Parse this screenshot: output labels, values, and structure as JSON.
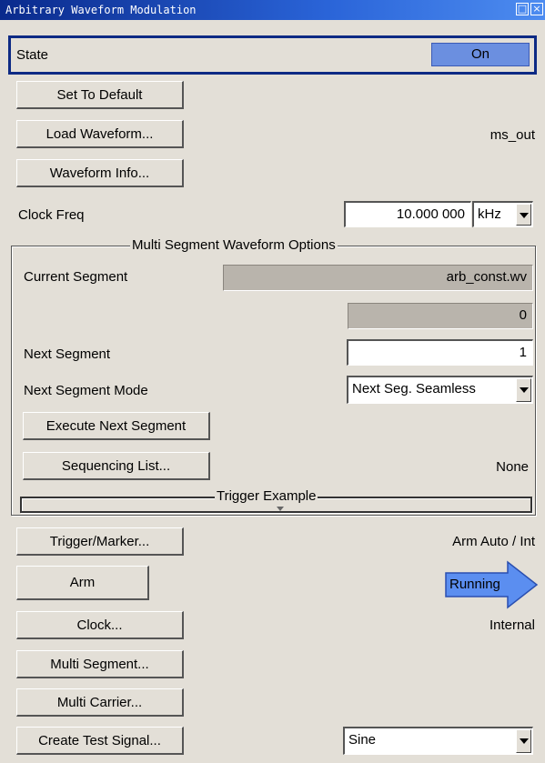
{
  "window": {
    "title": "Arbitrary Waveform Modulation"
  },
  "state": {
    "label": "State",
    "value": "On"
  },
  "buttons": {
    "set_default": "Set To Default",
    "load_waveform": "Load Waveform...",
    "waveform_info": "Waveform Info...",
    "execute_next": "Execute Next Segment",
    "sequencing_list": "Sequencing List...",
    "trigger_marker": "Trigger/Marker...",
    "arm": "Arm",
    "clock": "Clock...",
    "multi_segment": "Multi Segment...",
    "multi_carrier": "Multi Carrier...",
    "create_test_signal": "Create Test Signal..."
  },
  "waveform_file": "ms_out",
  "clock_freq": {
    "label": "Clock Freq",
    "value": "10.000 000",
    "unit": "kHz"
  },
  "multi_segment": {
    "title": "Multi Segment Waveform Options",
    "current_label": "Current Segment",
    "current_value": "arb_const.wv",
    "current_index": "0",
    "next_label": "Next Segment",
    "next_value": "1",
    "mode_label": "Next Segment Mode",
    "mode_value": "Next Seg. Seamless",
    "sequencing_value": "None"
  },
  "trigger_example": {
    "title": "Trigger Example"
  },
  "trigger_status": "Arm Auto / Int",
  "running_label": "Running",
  "clock_status": "Internal",
  "test_signal": "Sine",
  "colors": {
    "title_bar": "#0a2a8c",
    "state_on": "#6b8fe0",
    "running_arrow": "#5b8ef0",
    "background": "#e3dfd7"
  }
}
